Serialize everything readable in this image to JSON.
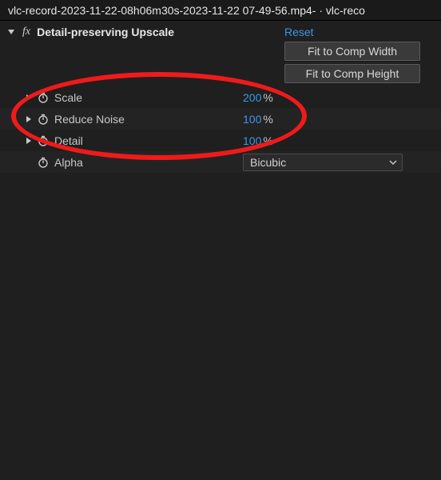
{
  "titlebar": "vlc-record-2023-11-22-08h06m30s-2023-11-22 07-49-56.mp4- · vlc-reco",
  "effect": {
    "fx_badge": "fx",
    "name": "Detail-preserving Upscale",
    "reset": "Reset",
    "fit_width": "Fit to Comp Width",
    "fit_height": "Fit to Comp Height"
  },
  "props": {
    "scale": {
      "label": "Scale",
      "value": "200",
      "unit": "%"
    },
    "reduceNoise": {
      "label": "Reduce Noise",
      "value": "100",
      "unit": "%"
    },
    "detail": {
      "label": "Detail",
      "value": "100",
      "unit": "%"
    },
    "alpha": {
      "label": "Alpha",
      "value": "Bicubic"
    }
  }
}
